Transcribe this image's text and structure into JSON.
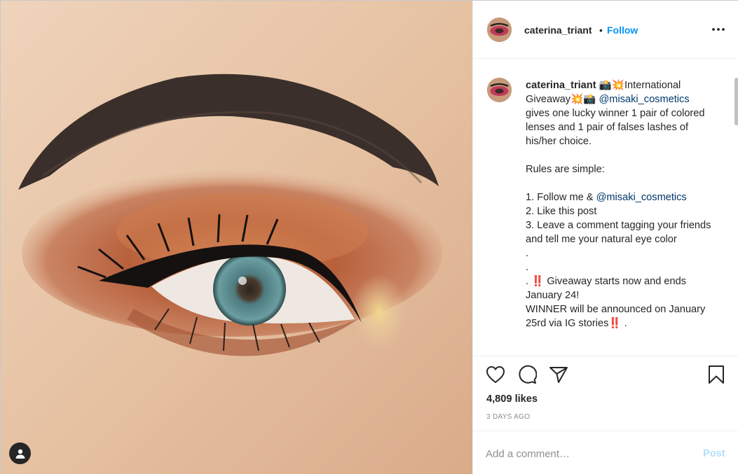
{
  "post": {
    "username": "caterina_triant",
    "follow_label": "Follow",
    "header_separator": "•",
    "more_label": "More options",
    "caption": {
      "username": "caterina_triant",
      "line1_text": " 📸💥International Giveaway💥📸 ",
      "mention_primary": "@misaki_cosmetics",
      "line1_tail": " gives one lucky winner 1 pair of colored lenses and 1 pair of falses lashes of his/her choice.",
      "rules_intro": "Rules are simple:",
      "rule1_prefix": "1. Follow me & ",
      "rule1_mention": "@misaki_cosmetics",
      "rule2": "2. Like this post",
      "rule3": "3. Leave a comment tagging your friends and tell me your natural eye color",
      "dot1": ".",
      "dot2": ".",
      "giveaway_line": ". ‼️ Giveaway starts now and ends January 24!",
      "winner_line": "WINNER will be announced on January 25rd via IG stories‼️ ."
    },
    "likes": "4,809 likes",
    "timestamp": "3 DAYS AGO",
    "comment_placeholder": "Add a comment…",
    "post_label": "Post"
  },
  "icons": {
    "like": "heart-icon",
    "comment": "comment-bubble-icon",
    "share": "paper-plane-icon",
    "save": "bookmark-icon",
    "more": "ellipsis-icon",
    "tagged_user": "user-icon"
  },
  "colors": {
    "accent": "#0095f6",
    "post_disabled": "#b2dffc",
    "mention": "#00376b",
    "muted": "#8e8e8e"
  }
}
